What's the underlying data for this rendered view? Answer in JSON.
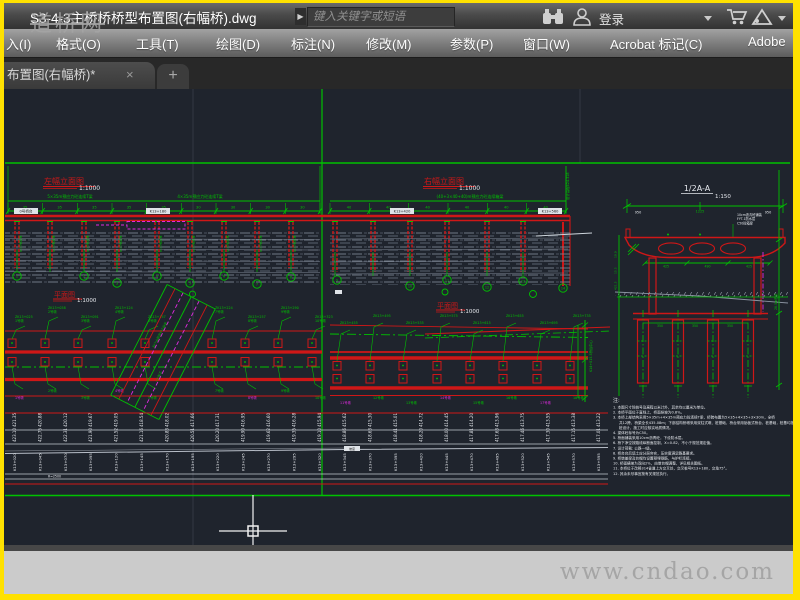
{
  "frame": {
    "border_color": "#ffe100",
    "watermark_top": "道桥网",
    "watermark_bottom": "www.cndao.com"
  },
  "title_bar": {
    "document_title": "S3-4-3主桥桥桥型布置图(右幅桥).dwg",
    "expand_arrow": "▶",
    "search_placeholder": "键入关键字或短语",
    "login_label": "登录"
  },
  "menu_bar": {
    "items": [
      "入(I)",
      "格式(O)",
      "工具(T)",
      "绘图(D)",
      "标注(N)",
      "修改(M)",
      "参数(P)",
      "窗口(W)",
      "Acrobat 标记(C)",
      "Adobe"
    ]
  },
  "tab_bar": {
    "active_tab": "布置图(右幅桥)*",
    "close_glyph": "×",
    "new_tab_glyph": "+"
  },
  "drawing": {
    "left_elevation": {
      "title": "左幅立面图",
      "scale": "1:1000",
      "span_text_1": "5×35m预应力砼连续T梁",
      "span_text_2": "4×35m预应力砼连续T梁",
      "spans": [
        "35",
        "35",
        "35",
        "35",
        "35",
        "30",
        "30",
        "30",
        "30"
      ],
      "deck_labels": [
        "0号桥台",
        "K13+180"
      ],
      "pier_note": "φ150钻孔桩",
      "borehole_ids": [
        "1",
        "2",
        "3",
        "4",
        "5",
        "6",
        "7",
        "8"
      ]
    },
    "right_elevation": {
      "title": "右幅立面图",
      "scale": "1:1000",
      "span_text": "(40+3×40+40)m预应力砼连续箱梁",
      "spans": [
        "40",
        "40",
        "40",
        "40",
        "40",
        "40"
      ],
      "deck_labels": [
        "K13+420",
        "K13+560"
      ],
      "borehole_ids": [
        "9",
        "10",
        "11",
        "12",
        "13",
        "14"
      ],
      "axis_note": "设计高程424.318"
    },
    "section": {
      "title": "1/2A-A",
      "scale": "1:150",
      "dim_top_left": "950",
      "dim_top_mid": "1225",
      "dim_top_right": "950",
      "layers": [
        "10cm沥青砼铺装",
        "FYT-1防水层",
        "C50砼箱梁"
      ],
      "dims_bottom": [
        "425",
        "490",
        "425"
      ],
      "pile_dims": [
        "350",
        "350",
        "350"
      ],
      "left_axis": [
        "10.0",
        "15.5",
        "421.5"
      ],
      "right_axis": "28.5m桩长"
    },
    "left_plan": {
      "title": "平面图",
      "scale": "1:1000",
      "pier_labels_top": [
        "ZK13+025",
        "ZK13+058",
        "ZK13+091",
        "ZK13+124",
        "ZK13+157",
        "ZK13+224",
        "ZK13+257",
        "ZK13+290",
        "ZK13+323"
      ],
      "pier_labels_bottom": [
        "1号墩",
        "2号墩",
        "3号墩",
        "4号墩",
        "5号墩",
        "7号墩",
        "8号墩",
        "9号墩",
        "10号墩"
      ],
      "skew_label_1": "改移314省道中心线",
      "skew_label_2": "交角75°"
    },
    "right_plan": {
      "title": "平面图",
      "scale": "1:1000",
      "pier_labels_top": [
        "ZK13+455",
        "ZK13+495",
        "ZK13+535",
        "ZK13+575",
        "ZK13+615",
        "ZK13+655",
        "ZK13+695",
        "ZK13+735"
      ],
      "pier_labels_bottom": [
        "11号墩",
        "12号墩",
        "13号墩",
        "14号墩",
        "15号墩",
        "16号墩",
        "17号墩",
        "18号墩"
      ],
      "end_label": "K14+015.5桥台中心"
    },
    "profile_table": {
      "grade_label": "坡度",
      "radius_label": "R=2500",
      "deck_elev": [
        "421.35",
        "420.88",
        "420.12",
        "419.67",
        "419.05",
        "418.54",
        "418.02",
        "417.66",
        "417.31",
        "416.95",
        "416.60",
        "416.28",
        "415.94",
        "415.62",
        "415.30",
        "415.01",
        "414.72",
        "414.45",
        "414.20",
        "413.96",
        "413.75",
        "413.55",
        "413.38",
        "413.22"
      ],
      "ground_elev": [
        "423.10",
        "422.75",
        "422.31",
        "421.90",
        "421.52",
        "421.16",
        "420.83",
        "420.51",
        "420.20",
        "419.90",
        "419.62",
        "419.35",
        "419.10",
        "418.86",
        "418.63",
        "418.41",
        "418.20",
        "418.00",
        "417.81",
        "417.63",
        "417.46",
        "417.30",
        "417.15",
        "417.01"
      ],
      "stations": [
        "K13+020",
        "K13+045",
        "K13+070",
        "K13+095",
        "K13+120",
        "K13+145",
        "K13+170",
        "K13+195",
        "K13+220",
        "K13+245",
        "K13+270",
        "K13+295",
        "K13+320",
        "K13+345",
        "K13+370",
        "K13+395",
        "K13+420",
        "K13+445",
        "K13+470",
        "K13+495",
        "K13+520",
        "K13+545",
        "K13+570",
        "K13+595"
      ]
    },
    "notes": {
      "heading": "注:",
      "lines": [
        "1. 本图尺寸除桩号及高程以米计外，其余均以厘米为单位。",
        "2. 本桥平面位于直线上，桥面纵坡为0.8%。",
        "3. 本桥上部结构采用5×35m+4×35m预应力砼连续T梁，桥跨布置为5×35+4×35+3×30m，全桥共12跨，桥梁全长435.08m；下部结构桥墩采用双柱式墩、桩基础，桥台采用肋板式桥台、桩基础，桩基均按摩擦桩设计，施工时应核实地质情况。",
        "4. 梁体砼标号为C50。",
        "5. 桥面铺装采用10cm沥青砼，下设防水层。",
        "6. 桥下净空按路线纵断面控制，X=0.82，不小于规范规定值。",
        "7. 设计荷载: 公路—Ⅰ级。",
        "8. 桥台台后填土应分层夯实，压实度满足路基要求。",
        "9. 桥墩盖梁及台帽均设置预埋钢筋，与护栏连接。",
        "10. 桥面横坡为双向2%，由墩台帽调整，详见相关图纸。",
        "11. 本桥位于改移314省道上方交叉处，交叉桩号K13+180，交角75°。",
        "12. 其余未尽事宜按有关规范执行。"
      ]
    }
  }
}
